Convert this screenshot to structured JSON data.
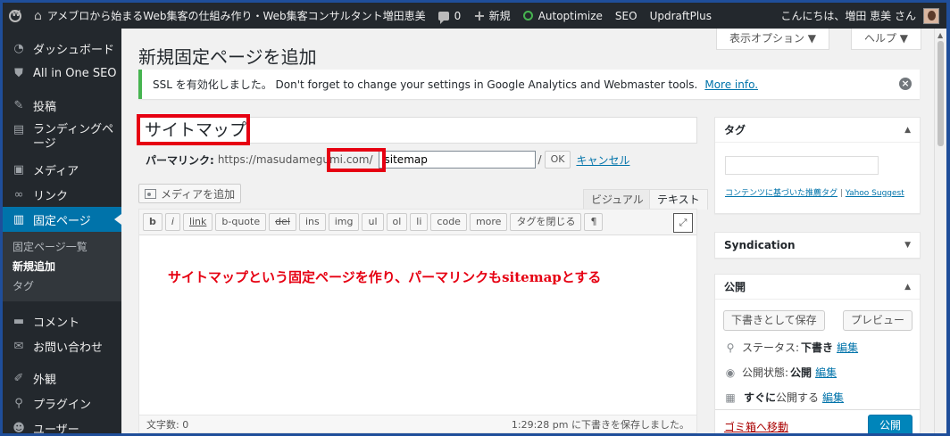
{
  "admin_bar": {
    "site_name": "アメブロから始まるWeb集客の仕組み作り・Web集客コンサルタント増田恵美",
    "comments_count": "0",
    "new_label": "新規",
    "items": [
      "Autoptimize",
      "SEO",
      "UpdraftPlus"
    ],
    "greeting": "こんにちは、増田 恵美 さん"
  },
  "sidebar": {
    "items": [
      {
        "label": "ダッシュボード",
        "icon": "dashboard-icon",
        "glyph": "◔"
      },
      {
        "label": "All in One SEO",
        "icon": "shield-icon",
        "glyph": "⛊"
      },
      {
        "label": "投稿",
        "icon": "pin-icon",
        "glyph": "✎"
      },
      {
        "label": "ランディングページ",
        "icon": "pages-icon",
        "glyph": "▤"
      },
      {
        "label": "メディア",
        "icon": "media-icon",
        "glyph": "▣"
      },
      {
        "label": "リンク",
        "icon": "link-icon",
        "glyph": "∞"
      },
      {
        "label": "固定ページ",
        "icon": "page-icon",
        "glyph": "▥"
      },
      {
        "label": "コメント",
        "icon": "comment-icon",
        "glyph": "▬"
      },
      {
        "label": "お問い合わせ",
        "icon": "mail-icon",
        "glyph": "✉"
      },
      {
        "label": "外観",
        "icon": "brush-icon",
        "glyph": "✐"
      },
      {
        "label": "プラグイン",
        "icon": "plugin-icon",
        "glyph": "⚲"
      },
      {
        "label": "ユーザー",
        "icon": "user-icon",
        "glyph": "☻"
      }
    ],
    "submenu": [
      "固定ページ一覧",
      "新規追加",
      "タグ"
    ]
  },
  "main": {
    "screen_options": "表示オプション ▼",
    "help": "ヘルプ ▼",
    "page_title": "新規固定ページを追加",
    "notice": {
      "text": "SSL を有効化しました。 Don't forget to change your settings in Google Analytics and Webmaster tools.",
      "link": "More info.",
      "dismiss": "×"
    },
    "post_title": "サイトマップ",
    "permalink": {
      "label": "パーマリンク:",
      "base_url": "https://masudamegumi.com/",
      "slug": "sitemap",
      "slash": "/",
      "ok": "OK",
      "cancel": "キャンセル"
    },
    "media_button": "メディアを追加",
    "tabs": {
      "visual": "ビジュアル",
      "text": "テキスト"
    },
    "quicktags": [
      "b",
      "i",
      "link",
      "b-quote",
      "del",
      "ins",
      "img",
      "ul",
      "ol",
      "li",
      "code",
      "more",
      "タグを閉じる",
      "¶"
    ],
    "annotation": "サイトマップという固定ページを作り、パーマリンクもsitemapとする",
    "word_count": "文字数: 0",
    "autosave": "1:29:28 pm に下書きを保存しました。"
  },
  "tags_box": {
    "title": "タグ",
    "toggle": "▲",
    "link": "コンテンツに基づいた推薦タグ",
    "divider": "|",
    "yahoo": "Yahoo Suggest"
  },
  "syndication_box": {
    "title": "Syndication",
    "toggle": "▼"
  },
  "publish_box": {
    "title": "公開",
    "toggle": "▲",
    "save_draft": "下書きとして保存",
    "preview": "プレビュー",
    "status_label": "ステータス:",
    "status_value": "下書き",
    "visibility_label": "公開状態:",
    "visibility_value": "公開",
    "schedule_prefix": "すぐに",
    "schedule_label": "公開する",
    "edit": "編集",
    "trash": "ゴミ箱へ移動",
    "publish": "公開"
  },
  "colors": {
    "frame": "#1f4e9a",
    "admin_bar": "#23282d",
    "accent": "#0073aa",
    "highlight": "#e60012",
    "notice_border": "#46b450"
  }
}
